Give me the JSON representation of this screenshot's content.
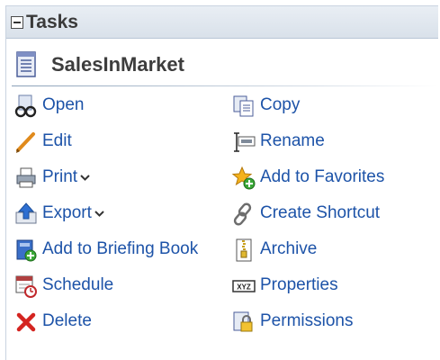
{
  "panel": {
    "header_title": "Tasks"
  },
  "document": {
    "title": "SalesInMarket"
  },
  "actions_left": [
    {
      "label": "Open",
      "icon": "open-glasses-icon"
    },
    {
      "label": "Edit",
      "icon": "pencil-icon"
    },
    {
      "label": "Print",
      "icon": "printer-icon",
      "has_dropdown": true
    },
    {
      "label": "Export",
      "icon": "export-arrow-icon",
      "has_dropdown": true
    },
    {
      "label": "Add to Briefing Book",
      "icon": "briefing-book-icon"
    },
    {
      "label": "Schedule",
      "icon": "schedule-clock-icon"
    },
    {
      "label": "Delete",
      "icon": "delete-x-icon"
    }
  ],
  "actions_right": [
    {
      "label": "Copy",
      "icon": "copy-icon"
    },
    {
      "label": "Rename",
      "icon": "rename-icon"
    },
    {
      "label": "Add to Favorites",
      "icon": "favorites-star-icon"
    },
    {
      "label": "Create Shortcut",
      "icon": "shortcut-chain-icon"
    },
    {
      "label": "Archive",
      "icon": "archive-zip-icon"
    },
    {
      "label": "Properties",
      "icon": "properties-xyz-icon"
    },
    {
      "label": "Permissions",
      "icon": "permissions-lock-icon"
    }
  ],
  "colors": {
    "link": "#1d53a8",
    "header_bg": "#dfe6ee"
  }
}
